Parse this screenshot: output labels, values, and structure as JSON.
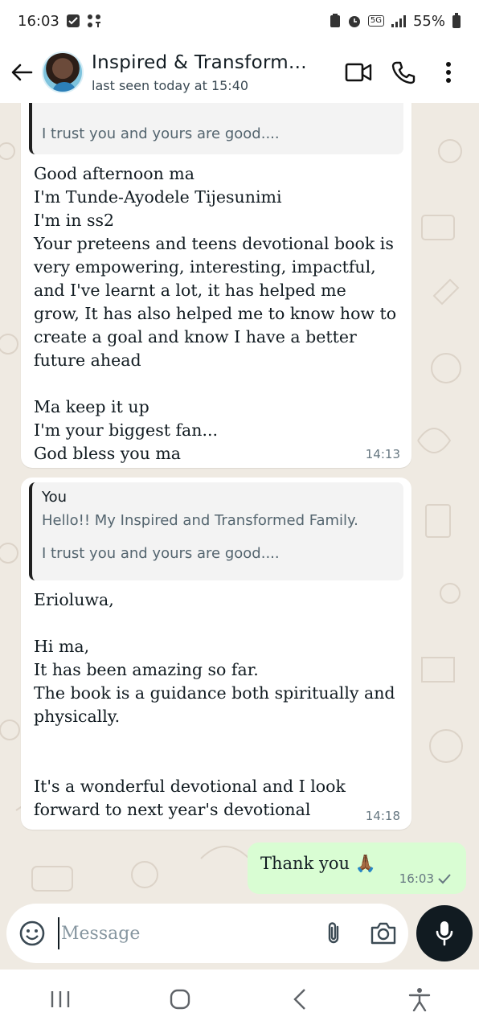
{
  "status_bar": {
    "time": "16:03",
    "network": "5G",
    "battery": "55%"
  },
  "header": {
    "contact_name": "Inspired & Transform...",
    "last_seen": "last seen today at 15:40",
    "icons": [
      "back-arrow-icon",
      "video-call-icon",
      "voice-call-icon",
      "more-vert-icon"
    ]
  },
  "messages": [
    {
      "quote_line": "I trust you and yours are good....",
      "text": "Good afternoon ma\nI'm Tunde-Ayodele Tijesunimi\nI'm in ss2\nYour preteens and teens devotional book is very empowering, interesting, impactful, and I've learnt a lot, it has helped me grow, It has also helped me to know how to create a goal and know I have a better future ahead\n\nMa keep it up\nI'm your biggest fan...\nGod bless you ma",
      "time": "14:13"
    },
    {
      "quote_sender": "You",
      "quote_line1": "Hello!! My Inspired and Transformed Family.",
      "quote_line2": "I trust you and yours are good....",
      "text": "Erioluwa,\n\nHi ma,\nIt has been amazing so far.\nThe book is a guidance both spiritually and physically.\n\n\nIt's a wonderful devotional and I look forward to next year's devotional",
      "time": "14:18"
    }
  ],
  "outgoing": {
    "text": "Thank you",
    "emoji": "🙏🏾",
    "time": "16:03",
    "status_icon": "sent-check-icon"
  },
  "input": {
    "placeholder": "Message",
    "icons": [
      "emoji-icon",
      "attach-icon",
      "camera-icon",
      "mic-icon"
    ]
  },
  "colors": {
    "chat_background": "#efeae2",
    "incoming_bubble": "#ffffff",
    "outgoing_bubble": "#d9fdd3",
    "mic_button": "#111b21"
  }
}
